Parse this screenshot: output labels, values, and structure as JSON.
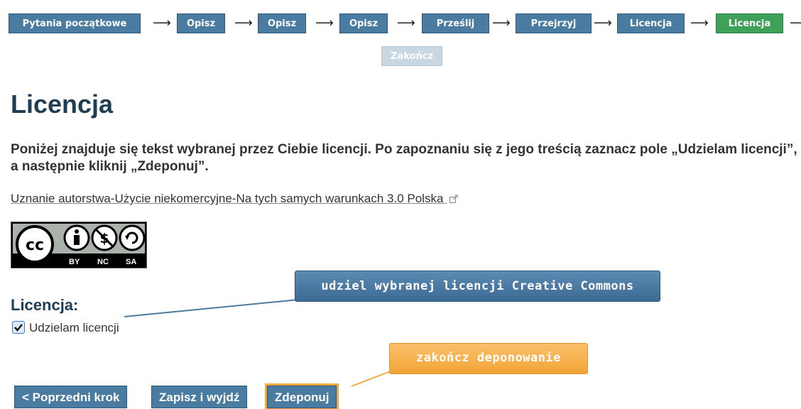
{
  "progress": {
    "steps": [
      {
        "label": "Pytania początkowe",
        "active": false
      },
      {
        "label": "Opisz",
        "active": false
      },
      {
        "label": "Opisz",
        "active": false
      },
      {
        "label": "Opisz",
        "active": false
      },
      {
        "label": "Prześlij",
        "active": false
      },
      {
        "label": "Przejrzyj",
        "active": false
      },
      {
        "label": "Licencja",
        "active": false
      },
      {
        "label": "Licencja",
        "active": true
      }
    ],
    "finish": "Zakończ"
  },
  "page": {
    "title": "Licencja",
    "intro": "Poniżej znajduje się tekst wybranej przez Ciebie licencji. Po zapoznaniu się z jego treścią zaznacz pole „Udzielam licencji”, a następnie kliknij „Zdeponuj”.",
    "license_link": "Uznanie autorstwa-Użycie niekomercyjne-Na tych samych warunkach 3.0 Polska",
    "cc_badge": {
      "by": "BY",
      "nc": "NC",
      "sa": "SA"
    },
    "license_heading": "Licencja:",
    "grant_label": "Udzielam licencji",
    "grant_checked": true
  },
  "buttons": {
    "prev": "< Poprzedni krok",
    "save": "Zapisz i wyjdź",
    "submit": "Zdeponuj"
  },
  "callouts": {
    "license": "udziel wybranej licencji Creative Commons",
    "submit": "zakończ deponowanie"
  },
  "colors": {
    "step": "#4a7ba0",
    "step_active": "#3fa05a",
    "callout_blue": "#4a7ba0",
    "callout_orange": "#f4a940"
  }
}
